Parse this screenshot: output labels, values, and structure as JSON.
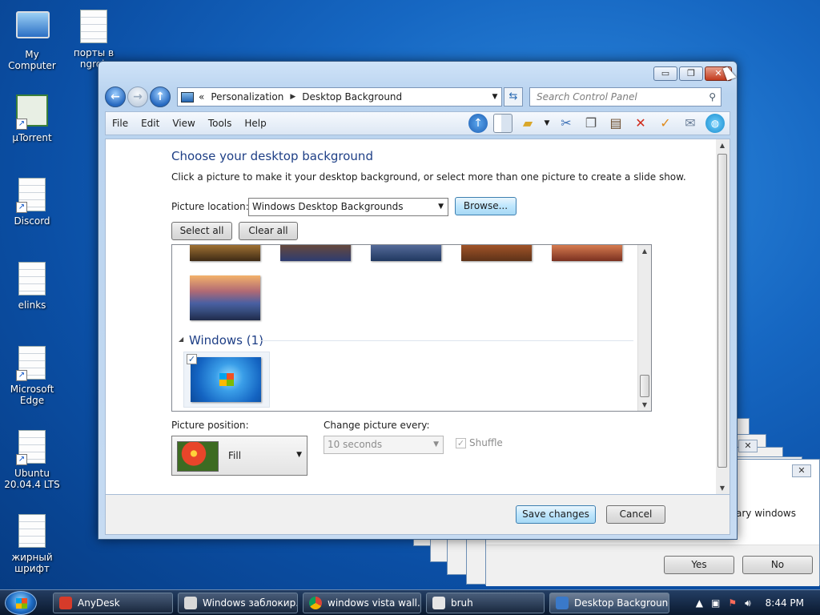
{
  "desktop": {
    "icons": [
      {
        "label": "My Computer"
      },
      {
        "label": "порты в ngrok"
      },
      {
        "label": "µTorrent"
      },
      {
        "label": "Discord"
      },
      {
        "label": "elinks"
      },
      {
        "label": "Microsoft Edge"
      },
      {
        "label": "Ubuntu 20.04.4 LTS"
      },
      {
        "label": "жирный шрифт"
      }
    ]
  },
  "background_dialog": {
    "text": "ary windows",
    "yes_label": "Yes",
    "no_label": "No",
    "close_glyph": "✕"
  },
  "window": {
    "controls": {
      "minimize": "▭",
      "maximize": "❐",
      "close": "✕"
    },
    "breadcrumb": {
      "prefix": "«",
      "items": [
        "Personalization",
        "Desktop Background"
      ],
      "separator": "▶"
    },
    "search": {
      "placeholder": "Search Control Panel"
    },
    "menu": {
      "file": "File",
      "edit": "Edit",
      "view": "View",
      "tools": "Tools",
      "help": "Help"
    },
    "title": "Choose your desktop background",
    "subtitle": "Click a picture to make it your desktop background, or select more than one picture to create a slide show.",
    "picture_location_label": "Picture location:",
    "picture_location_value": "Windows Desktop Backgrounds",
    "browse_label": "Browse...",
    "select_all_label": "Select all",
    "clear_all_label": "Clear all",
    "group_windows_label": "Windows (1)",
    "picture_position_label": "Picture position:",
    "picture_position_value": "Fill",
    "change_picture_label": "Change picture every:",
    "change_picture_value": "10 seconds",
    "shuffle_label": "Shuffle",
    "save_label": "Save changes",
    "cancel_label": "Cancel"
  },
  "taskbar": {
    "tasks": [
      {
        "label": "AnyDesk",
        "color": "#d63b2a"
      },
      {
        "label": "Windows заблокир...",
        "color": "#d8d8d8"
      },
      {
        "label": "windows vista wall...",
        "color": "#2f9c3f"
      },
      {
        "label": "bruh",
        "color": "#e5e5e5"
      },
      {
        "label": "Desktop Background",
        "color": "#3a79c9"
      }
    ],
    "clock": "8:44 PM"
  },
  "colors": {
    "title_blue": "#1e3f86",
    "accent": "#3c7fb1"
  }
}
